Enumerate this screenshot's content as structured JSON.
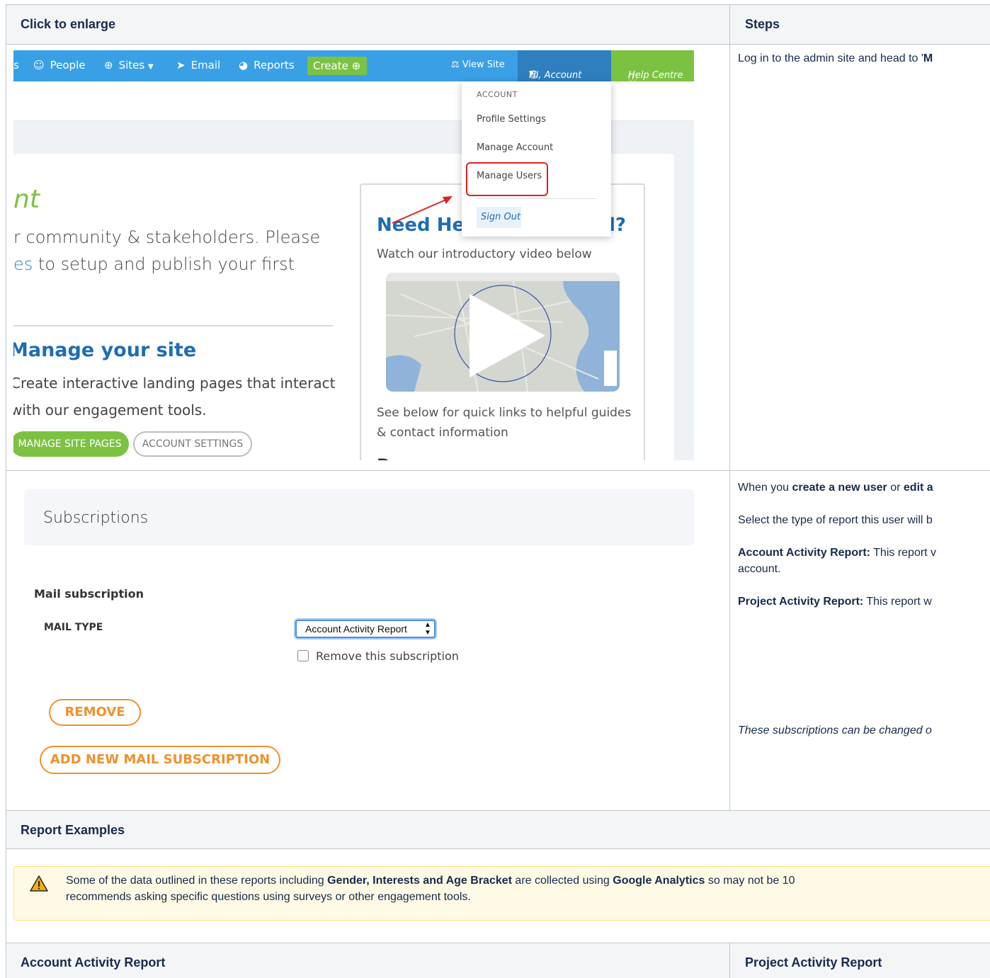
{
  "table": {
    "header_left": "Click to enlarge",
    "header_right": "Steps",
    "row_report_examples": "Report Examples",
    "footer_left": "Account Activity Report",
    "footer_right": "Project Activity Report"
  },
  "screenshot1": {
    "nav": {
      "cut_s": "s",
      "people": "People",
      "sites": "Sites",
      "email": "Email",
      "reports": "Reports",
      "create": "Create",
      "view_site": "View Site",
      "account": "Hi, Account",
      "help_centre": "Help Centre"
    },
    "dropdown": {
      "header": "ACCOUNT",
      "profile_settings": "Profile Settings",
      "manage_account": "Manage Account",
      "manage_users": "Manage Users",
      "sign_out": "Sign Out"
    },
    "page": {
      "green_tail": "nt",
      "intro_line1": "r community & stakeholders. Please",
      "intro_line2_blue": "es",
      "intro_line2_rest": " to setup and publish your first",
      "manage_title": "Manage your site",
      "manage_line1": "Create interactive landing pages that interact",
      "manage_line2": "with our engagement tools.",
      "btn_manage_site_pages": "MANAGE SITE PAGES",
      "btn_account_settings": "ACCOUNT SETTINGS",
      "need_help_start": "Need Hel",
      "need_help_end": "l?",
      "watch": "Watch our introductory video below",
      "see_below_1": "See below for quick links to helpful guides",
      "see_below_2": "& contact information",
      "documentation_cut": "D"
    }
  },
  "screenshot2": {
    "banner": "Subscriptions",
    "mail_subscription": "Mail subscription",
    "mail_type_label": "MAIL TYPE",
    "mail_type_value": "Account Activity Report",
    "remove_checkbox_label": "Remove this subscription",
    "btn_remove": "REMOVE",
    "btn_add_new": "ADD NEW MAIL SUBSCRIPTION"
  },
  "steps": {
    "step1_text": "Log in to the admin site and head to '",
    "step1_bold": "M",
    "step2_a": "When you ",
    "step2_b": "create a new user",
    "step2_c": " or ",
    "step2_d": "edit a",
    "step3": "Select the type of report this user will b",
    "step4_bold": "Account Activity Report:",
    "step4_text": " This report v",
    "step4_line2": "account.",
    "step5_bold": "Project Activity Report:",
    "step5_text": " This report w",
    "step6": "These subscriptions can be changed o"
  },
  "warning": {
    "line1_a": "Some of the data outlined in these reports including ",
    "line1_b": "Gender, Interests and Age Bracket",
    "line1_c": " are collected using ",
    "line1_d": "Google Analytics",
    "line1_e": " so may not be 10",
    "line2": "recommends asking specific questions using surveys or other engagement tools."
  },
  "colors": {
    "nav_blue": "#3aa0e6",
    "accent_green": "#7cc242",
    "orange": "#f0912b",
    "red_highlight": "#e02020",
    "warning_bg": "#fffae6"
  }
}
